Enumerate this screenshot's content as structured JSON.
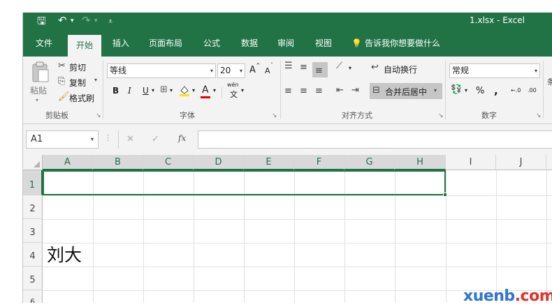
{
  "title_bar": {
    "doc_title": "1.xlsx - Excel",
    "save_glyph": "🖫",
    "undo_glyph": "↶",
    "undo_drop": "▾",
    "redo_glyph": "↷",
    "redo_drop": "▾",
    "customize_glyph": "⩡"
  },
  "tabs": [
    {
      "label": "文件"
    },
    {
      "label": "开始"
    },
    {
      "label": "插入"
    },
    {
      "label": "页面布局"
    },
    {
      "label": "公式"
    },
    {
      "label": "数据"
    },
    {
      "label": "审阅"
    },
    {
      "label": "视图"
    }
  ],
  "tell_me": "告诉我你想要做什么",
  "ribbon": {
    "clipboard": {
      "paste": "粘贴",
      "cut": "剪切",
      "copy": "复制",
      "format_painter": "格式刷",
      "label": "剪贴板"
    },
    "font": {
      "name": "等线",
      "size": "20",
      "grow": "A",
      "shrink": "A",
      "bold": "B",
      "italic": "I",
      "underline": "U",
      "font_color": "A",
      "phonetic": "wén",
      "phonetic_char": "文",
      "label": "字体"
    },
    "alignment": {
      "wrap_text": "自动换行",
      "merge_center": "合并后居中",
      "label": "对齐方式"
    },
    "number": {
      "format": "常规",
      "percent": "%",
      "comma": ",",
      "inc_decimal": "←.0",
      "dec_decimal": ".00",
      "label": "数字"
    }
  },
  "formula_bar": {
    "name_box": "A1",
    "cancel": "✕",
    "enter": "✓",
    "fx": "fx",
    "content": ""
  },
  "sheet": {
    "columns": [
      "A",
      "B",
      "C",
      "D",
      "E",
      "F",
      "G",
      "H",
      "I",
      "J"
    ],
    "rows": [
      "1",
      "2",
      "3",
      "4",
      "5",
      "6"
    ],
    "cell_A4": "刘大"
  },
  "watermark": {
    "part1": "xuenb",
    "part2": ".com",
    "color1": "#2e74d4",
    "color2": "#e0322b"
  },
  "colors": {
    "accent": "#217346",
    "ribbon_bg": "#f3f3f3"
  }
}
